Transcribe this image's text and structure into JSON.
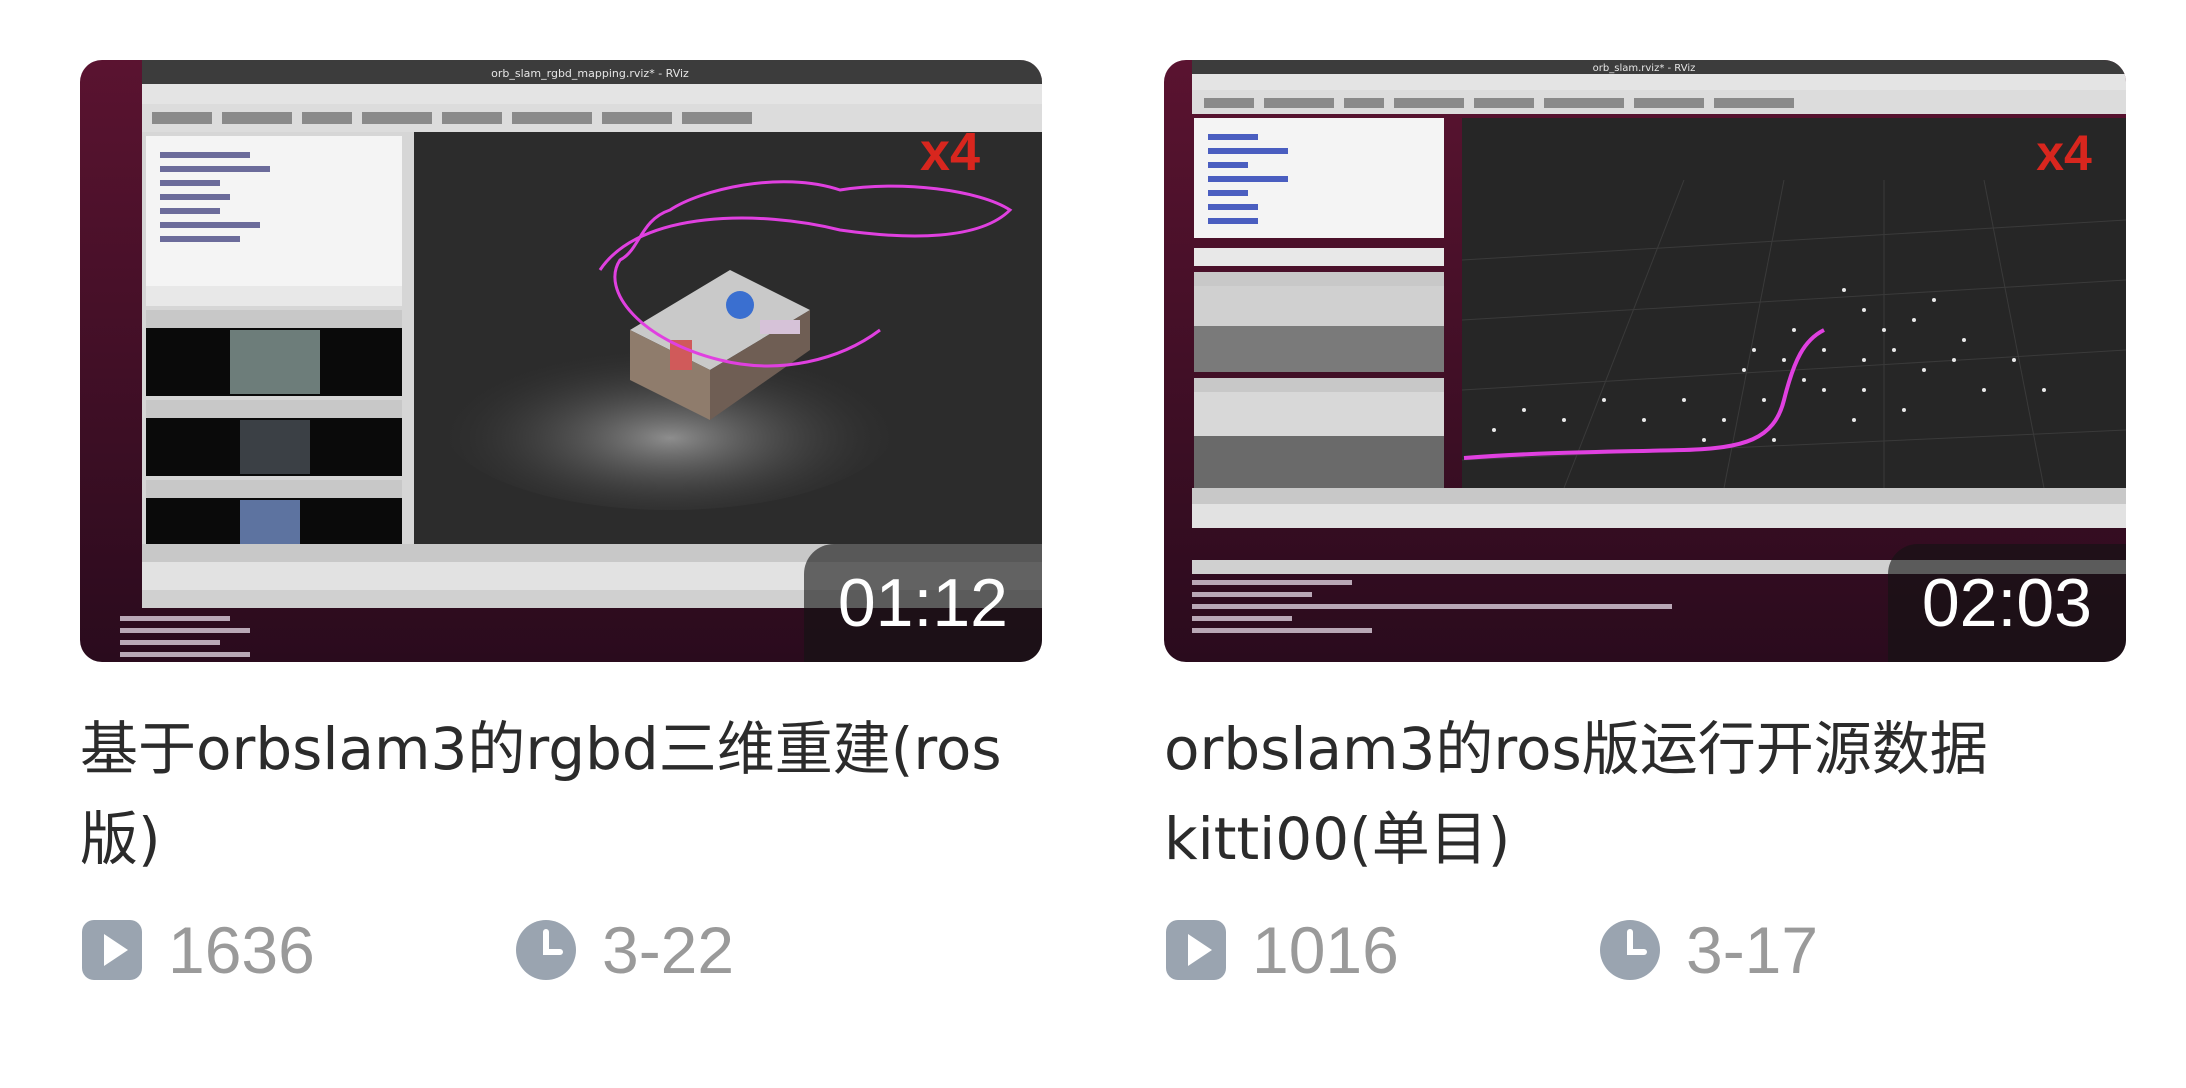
{
  "videos": [
    {
      "duration": "01:12",
      "title": "基于orbslam3的rgbd三维重建(ros版)",
      "play_count": "1636",
      "date": "3-22",
      "thumbnail_overlay": "x4",
      "window_title": "orb_slam_rgbd_mapping.rviz* - RViz"
    },
    {
      "duration": "02:03",
      "title": "orbslam3的ros版运行开源数据kitti00(单目)",
      "play_count": "1016",
      "date": "3-17",
      "thumbnail_overlay": "x4",
      "window_title": "orb_slam.rviz* - RViz"
    }
  ],
  "icons": {
    "play": "play-count-icon",
    "time": "clock-icon"
  },
  "colors": {
    "title": "#2b2b2b",
    "meta": "#9a9a9a",
    "overlay_text": "#d8261e",
    "path": "#e040e0"
  }
}
